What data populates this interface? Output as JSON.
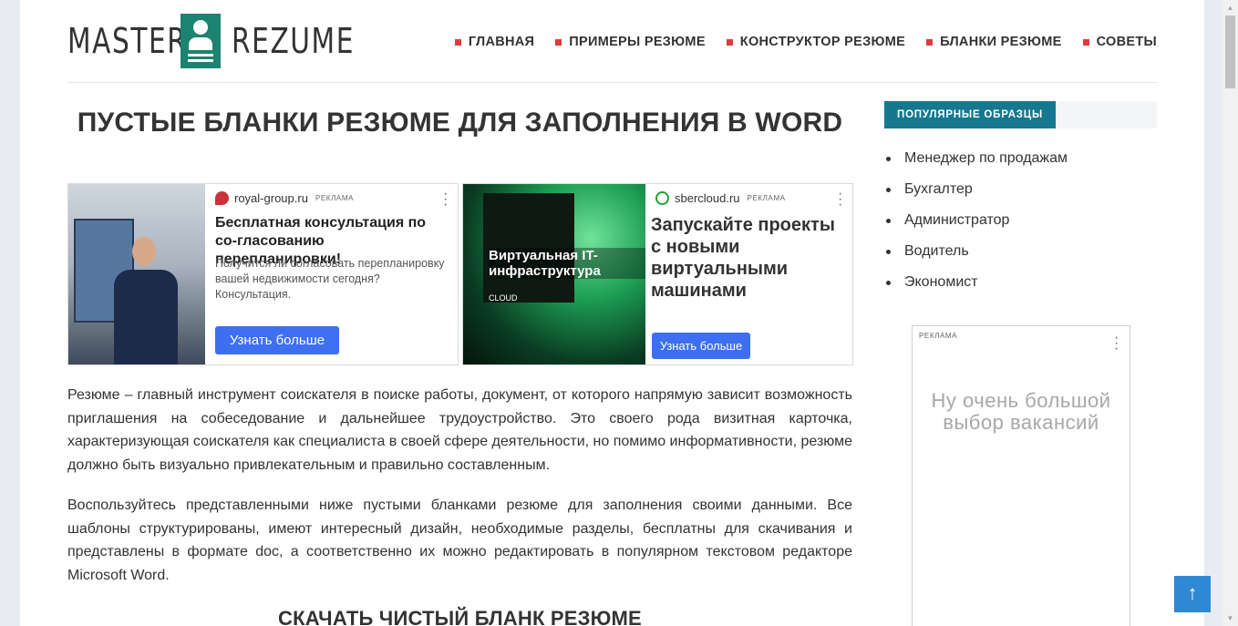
{
  "logo": {
    "word1": "MASTER",
    "word2": "REZUME"
  },
  "nav": [
    {
      "label": "ГЛАВНАЯ"
    },
    {
      "label": "ПРИМЕРЫ РЕЗЮМЕ"
    },
    {
      "label": "КОНСТРУКТОР РЕЗЮМЕ"
    },
    {
      "label": "БЛАНКИ РЕЗЮМЕ"
    },
    {
      "label": "СОВЕТЫ"
    }
  ],
  "main": {
    "title": "ПУСТЫЕ БЛАНКИ РЕЗЮМЕ ДЛЯ ЗАПОЛНЕНИЯ В WORD",
    "paragraph1": "Резюме – главный инструмент соискателя в поиске работы, документ, от которого напрямую зависит возможность приглашения на собеседование и дальнейшее трудоустройство. Это своего рода визитная карточка, характеризующая соискателя как специалиста в своей сфере деятельности, но помимо информативности, резюме должно быть визуально привлекательным и правильно составленным.",
    "paragraph2": "Воспользуйтесь представленными ниже пустыми бланками резюме для заполнения своими данными. Все шаблоны структурированы, имеют интересный дизайн, необходимые разделы, бесплатны для скачивания и представлены в формате doc, а соответственно их можно редактировать в популярном текстовом редакторе Microsoft Word.",
    "subhead": "СКАЧАТЬ ЧИСТЫЙ БЛАНК РЕЗЮМЕ"
  },
  "ads": [
    {
      "domain": "royal-group.ru",
      "tag": "РЕКЛАМА",
      "headline": "Бесплатная консультация по со-гласованию перепланировки!",
      "text": "Получится ли согласовать перепланировку вашей недвижимости сегодня? Консультация.",
      "button": "Узнать больше"
    },
    {
      "domain": "sbercloud.ru",
      "tag": "РЕКЛАМА",
      "image_text": "Виртуальная IT-инфраструктура",
      "image_brand": "CLOUD",
      "headline": "Запускайте проекты с новыми виртуальными машинами",
      "button": "Узнать больше"
    }
  ],
  "sidebar": {
    "heading": "ПОПУЛЯРНЫЕ ОБРАЗЦЫ",
    "items": [
      {
        "label": "Менеджер по продажам"
      },
      {
        "label": "Бухгалтер"
      },
      {
        "label": "Администратор"
      },
      {
        "label": "Водитель"
      },
      {
        "label": "Экономист"
      }
    ],
    "ad": {
      "tag": "РЕКЛАМА",
      "text": "Ну очень большой выбор вакансий"
    }
  },
  "colors": {
    "accent_red": "#e4393c",
    "logo_green": "#1c8371",
    "sidebar_head": "#15788f",
    "ad_button": "#3d6ff0",
    "to_top": "#2f88d3"
  },
  "icons": {
    "nav_bullet": "red-square-icon",
    "ad_menu": "kebab-icon",
    "to_top": "arrow-up-icon"
  }
}
